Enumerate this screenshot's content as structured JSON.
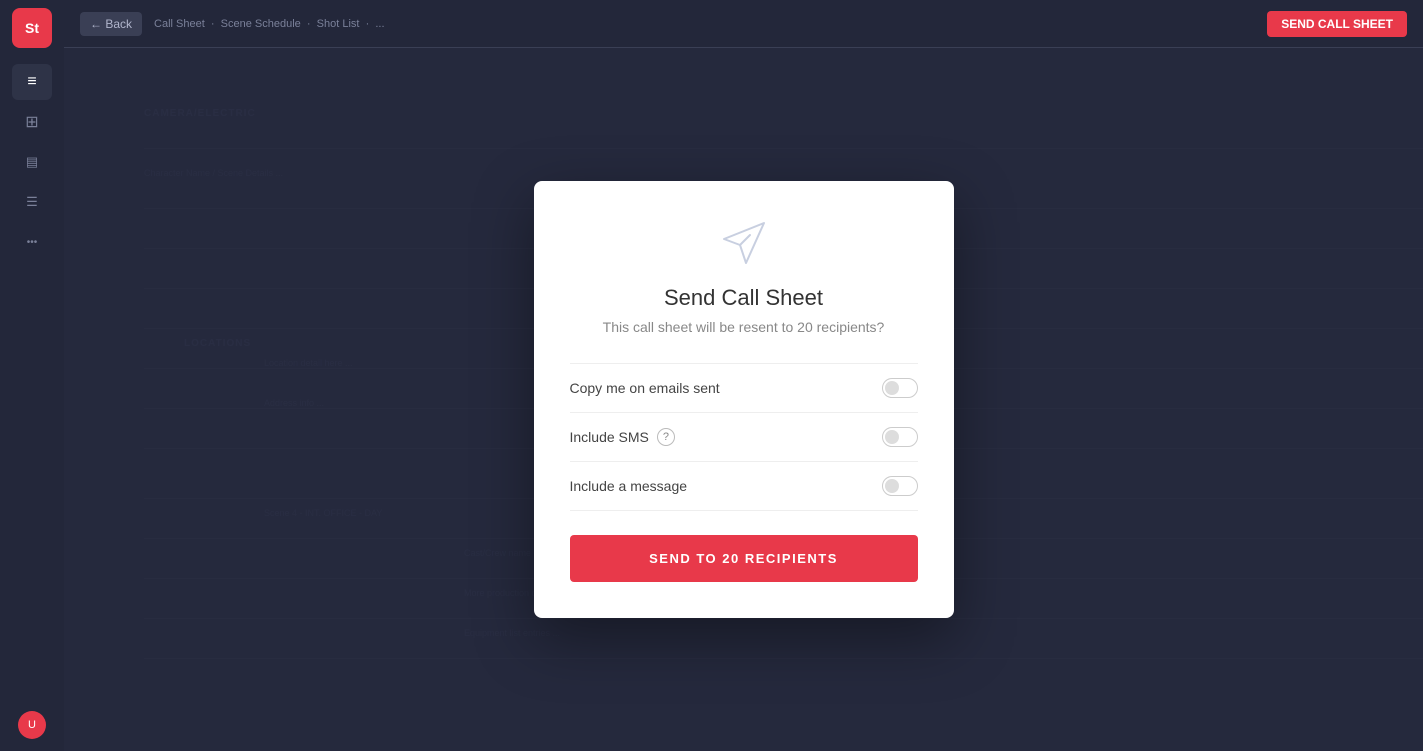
{
  "sidebar": {
    "logo_text": "St",
    "items": [
      {
        "icon": "≡",
        "label": "menu",
        "active": true
      },
      {
        "icon": "⊞",
        "label": "grid"
      },
      {
        "icon": "◫",
        "label": "layout"
      },
      {
        "icon": "≡",
        "label": "list"
      },
      {
        "icon": "◎",
        "label": "circle"
      }
    ],
    "bottom_items": [
      {
        "icon": "●",
        "label": "user-avatar"
      }
    ]
  },
  "topbar": {
    "back_button": "←",
    "nav_text": "Call Sheet  ·  Scene Schedule  ·  Shot List  ·  ...",
    "action_button": "SEND CALL SHEET"
  },
  "modal": {
    "icon": "paper-plane",
    "title": "Send Call Sheet",
    "subtitle": "This call sheet will be resent to 20 recipients?",
    "options": [
      {
        "id": "copy-me",
        "label": "Copy me on emails sent",
        "has_help": false,
        "toggled": false
      },
      {
        "id": "include-sms",
        "label": "Include SMS",
        "has_help": true,
        "toggled": false
      },
      {
        "id": "include-message",
        "label": "Include a message",
        "has_help": false,
        "toggled": false
      }
    ],
    "send_button": "SEND TO 20 RECIPIENTS",
    "recipients_count": 20
  },
  "background": {
    "section_label": "LOCATIONS",
    "colors": {
      "accent": "#e8394a",
      "bg_dark": "#23273a",
      "bg_mid": "#2e3347",
      "text_muted": "#4a5270"
    }
  }
}
